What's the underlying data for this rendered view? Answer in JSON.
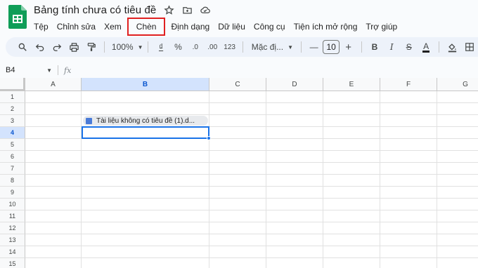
{
  "header": {
    "doc_title": "Bảng tính chưa có tiêu đề",
    "title_icons": [
      "star-icon",
      "move-to-folder-icon",
      "cloud-status-icon"
    ]
  },
  "menu": [
    "Tệp",
    "Chỉnh sửa",
    "Xem",
    "Chèn",
    "Định dạng",
    "Dữ liệu",
    "Công cụ",
    "Tiện ích mở rộng",
    "Trợ giúp"
  ],
  "highlighted_menu": "Chèn",
  "toolbar": {
    "zoom": "100%",
    "currency": "₫",
    "percent": "%",
    "decrease_decimal": ".0",
    "increase_decimal": ".00",
    "number_format": "123",
    "font": "Mặc đị...",
    "font_size": "10",
    "minus": "—",
    "plus": "+",
    "bold": "B",
    "italic": "I",
    "strike": "S",
    "text_color": "A"
  },
  "formula_bar": {
    "name_box": "B4",
    "fx": "fx"
  },
  "grid": {
    "columns": [
      "A",
      "B",
      "C",
      "D",
      "E",
      "F",
      "G"
    ],
    "rows": [
      "1",
      "2",
      "3",
      "4",
      "5",
      "6",
      "7",
      "8",
      "9",
      "10",
      "11",
      "12",
      "13",
      "14",
      "15"
    ],
    "selected_cell": "B4",
    "chip_cell": "B3",
    "chip_text": "Tài liệu không có tiêu đề (1).d..."
  },
  "colors": {
    "accent": "#1a73e8",
    "highlight_box": "#e02020",
    "sheets_green": "#0f9d58"
  }
}
